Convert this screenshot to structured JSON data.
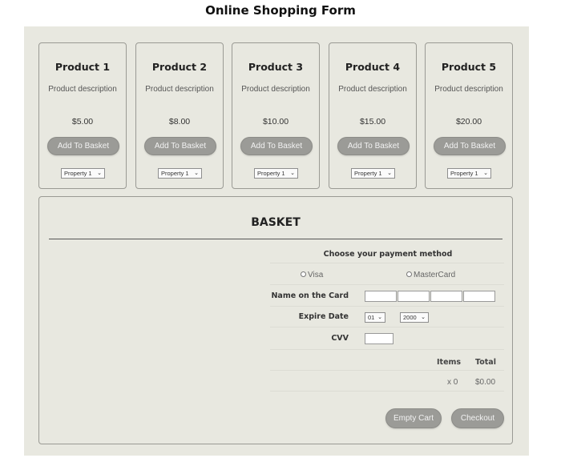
{
  "page_title": "Online Shopping Form",
  "products": [
    {
      "name": "Product 1",
      "description": "Product description",
      "price": "$5.00",
      "button": "Add To Basket",
      "property": "Property 1"
    },
    {
      "name": "Product 2",
      "description": "Product description",
      "price": "$8.00",
      "button": "Add To Basket",
      "property": "Property 1"
    },
    {
      "name": "Product 3",
      "description": "Product description",
      "price": "$10.00",
      "button": "Add To Basket",
      "property": "Property 1"
    },
    {
      "name": "Product 4",
      "description": "Product description",
      "price": "$15.00",
      "button": "Add To Basket",
      "property": "Property 1"
    },
    {
      "name": "Product 5",
      "description": "Product description",
      "price": "$20.00",
      "button": "Add To Basket",
      "property": "Property 1"
    }
  ],
  "basket": {
    "title": "BASKET",
    "payment_title": "Choose your payment method",
    "options": [
      "Visa",
      "MasterCard"
    ],
    "card_label": "Name on the Card",
    "expire_label": "Expire Date",
    "expire_month": "01",
    "expire_year": "2000",
    "cvv_label": "CVV",
    "items_header": "Items",
    "total_header": "Total",
    "items_value": "x 0",
    "total_value": "$0.00",
    "empty_cart": "Empty Cart",
    "checkout": "Checkout"
  },
  "colors": {
    "frame": "#e8e8e0",
    "button": "#9b9b97",
    "button_text": "#f2f2f2"
  }
}
